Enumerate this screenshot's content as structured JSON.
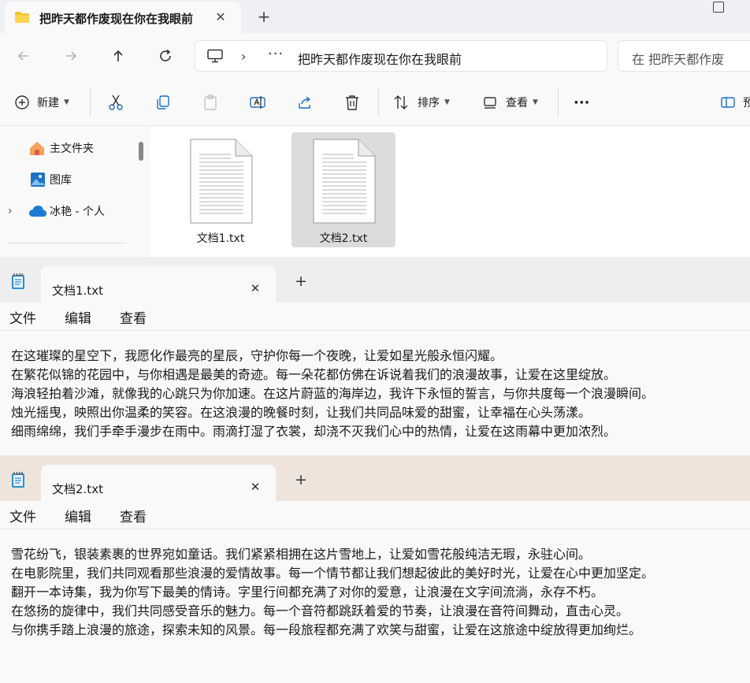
{
  "explorer": {
    "tab_title": "把昨天都作废现在你在我眼前",
    "address_path": "把昨天都作废现在你在我眼前",
    "search_placeholder": "在 把昨天都作废",
    "toolbar": {
      "new_label": "新建",
      "sort_label": "排序",
      "view_label": "查看",
      "more_label": "···",
      "partial_label": "预"
    },
    "sidebar": {
      "items": [
        {
          "label": "主文件夹",
          "icon": "home-icon"
        },
        {
          "label": "图库",
          "icon": "gallery-icon"
        },
        {
          "label": "冰艳 - 个人",
          "icon": "cloud-icon"
        }
      ]
    },
    "files": [
      {
        "name": "文档1.txt",
        "selected": false
      },
      {
        "name": "文档2.txt",
        "selected": true
      }
    ]
  },
  "notepad1": {
    "tab_title": "文档1.txt",
    "menu": [
      "文件",
      "编辑",
      "查看"
    ],
    "lines": [
      "在这璀璨的星空下，我愿化作最亮的星辰，守护你每一个夜晚，让爱如星光般永恒闪耀。",
      "在繁花似锦的花园中，与你相遇是最美的奇迹。每一朵花都仿佛在诉说着我们的浪漫故事，让爱在这里绽放。",
      "海浪轻拍着沙滩，就像我的心跳只为你加速。在这片蔚蓝的海岸边，我许下永恒的誓言，与你共度每一个浪漫瞬间。",
      "烛光摇曳，映照出你温柔的笑容。在这浪漫的晚餐时刻，让我们共同品味爱的甜蜜，让幸福在心头荡漾。",
      "细雨绵绵，我们手牵手漫步在雨中。雨滴打湿了衣裳，却浇不灭我们心中的热情，让爱在这雨幕中更加浓烈。"
    ]
  },
  "notepad2": {
    "tab_title": "文档2.txt",
    "menu": [
      "文件",
      "编辑",
      "查看"
    ],
    "lines": [
      "雪花纷飞，银装素裹的世界宛如童话。我们紧紧相拥在这片雪地上，让爱如雪花般纯洁无瑕，永驻心间。",
      "在电影院里，我们共同观看那些浪漫的爱情故事。每一个情节都让我们想起彼此的美好时光，让爱在心中更加坚定。",
      "翻开一本诗集，我为你写下最美的情诗。字里行间都充满了对你的爱意，让浪漫在文字间流淌，永存不朽。",
      "在悠扬的旋律中，我们共同感受音乐的魅力。每一个音符都跳跃着爱的节奏，让浪漫在音符间舞动，直击心灵。",
      "与你携手踏上浪漫的旅途，探索未知的风景。每一段旅程都充满了欢笑与甜蜜，让爱在这旅途中绽放得更加绚烂。"
    ]
  }
}
